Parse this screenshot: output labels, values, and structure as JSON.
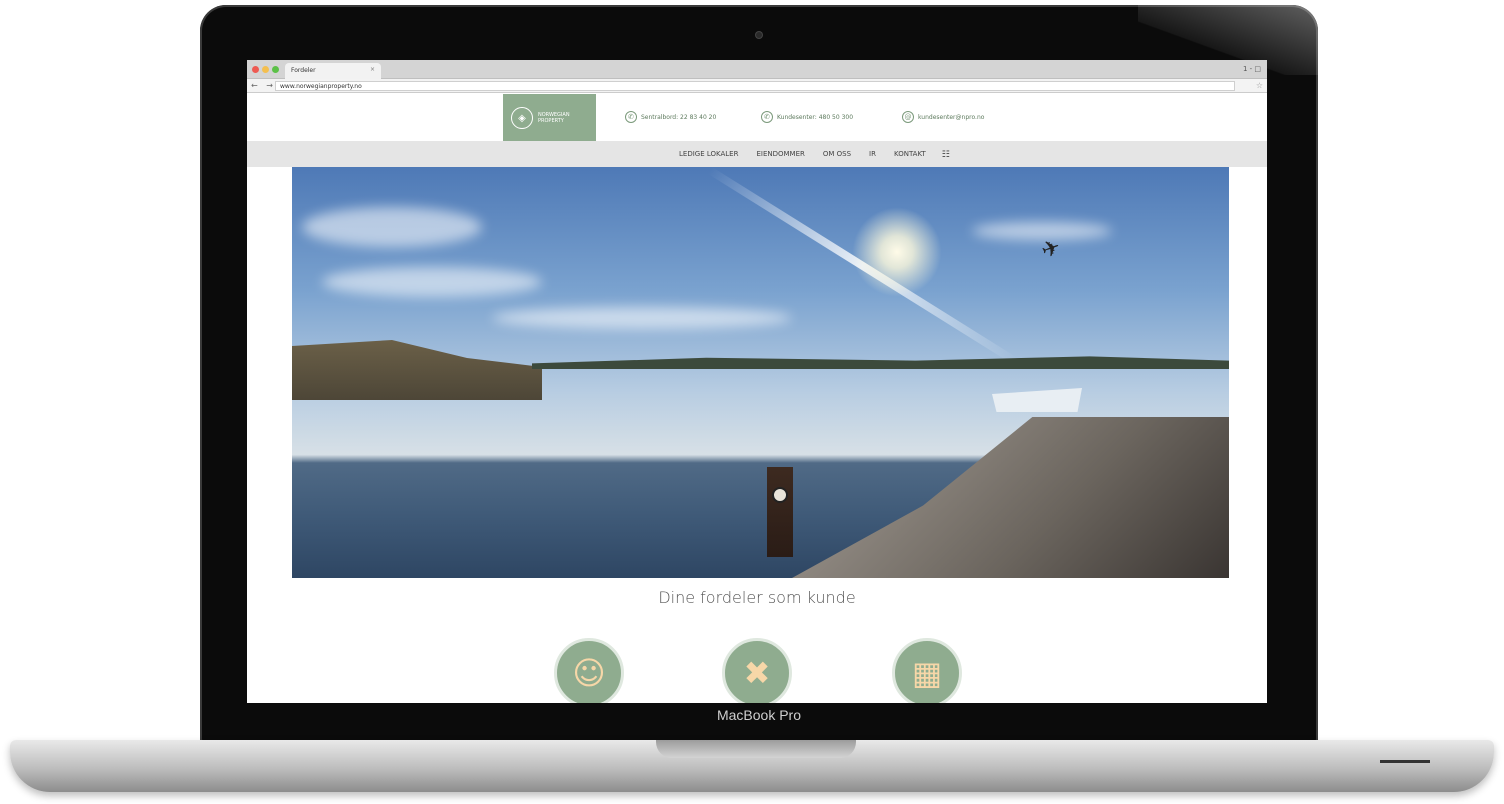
{
  "browser": {
    "tab_title": "Fordeler",
    "tab_close": "×",
    "url": "www.norwegianproperty.no",
    "nav_controls": "← → C",
    "star": "☆",
    "user_indicator": "1 - □"
  },
  "site": {
    "logo_text": "NORWEGIAN PROPERTY",
    "contacts": [
      {
        "label": "Sentralbord: 22 83 40 20",
        "icon": "phone-icon"
      },
      {
        "label": "Kundesenter: 480 50 300",
        "icon": "phone-icon"
      },
      {
        "label": "kundesenter@npro.no",
        "icon": "email-icon"
      }
    ],
    "nav": [
      "LEDIGE LOKALER",
      "EIENDOMMER",
      "OM OSS",
      "IR",
      "KONTAKT"
    ],
    "nav_icon": "menu-icon",
    "tagline": "Dine fordeler som kunde",
    "features": [
      {
        "icon": "smiley-icon"
      },
      {
        "icon": "tools-icon"
      },
      {
        "icon": "buildings-icon"
      }
    ]
  },
  "device": {
    "label": "MacBook Pro"
  },
  "colors": {
    "brand_green": "#8fac8f",
    "accent_peach": "#f7d7a8"
  }
}
